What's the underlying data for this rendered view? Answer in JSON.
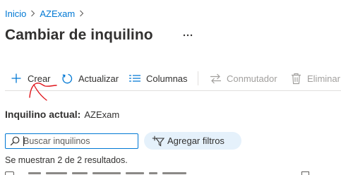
{
  "breadcrumb": {
    "items": [
      {
        "label": "Inicio"
      },
      {
        "label": "AZExam"
      }
    ],
    "separator": ">"
  },
  "page": {
    "title": "Cambiar de inquilino",
    "more_label": "···"
  },
  "toolbar": {
    "create": "Crear",
    "refresh": "Actualizar",
    "columns": "Columnas",
    "switch": "Conmutador",
    "delete": "Eliminar"
  },
  "tenant": {
    "label": "Inquilino actual:",
    "value": "AZExam"
  },
  "search": {
    "placeholder": "Buscar inquilinos",
    "value": ""
  },
  "filters": {
    "add_label": "Agregar filtros"
  },
  "results": {
    "text": "Se muestran 2 de 2 resultados."
  },
  "colors": {
    "accent": "#0078d4",
    "text": "#323130",
    "disabled": "#a19f9d",
    "pill": "#e5f1fb",
    "annotation": "#e0141a"
  },
  "icons": {
    "create": "plus-icon",
    "refresh": "refresh-icon",
    "columns": "columns-icon",
    "switch": "switch-arrows-icon",
    "delete": "trash-icon",
    "search": "search-icon",
    "filter": "add-filter-icon",
    "chevron": "chevron-right-icon"
  }
}
